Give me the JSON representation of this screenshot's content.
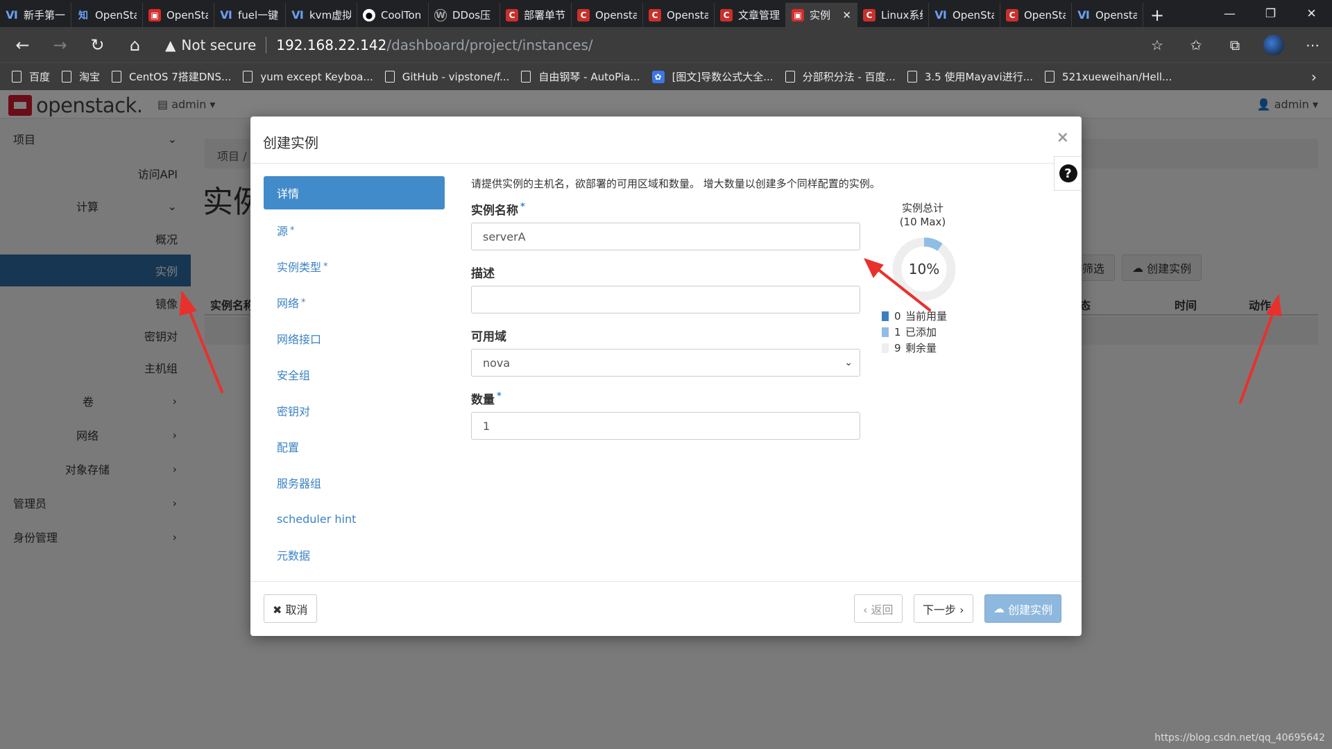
{
  "browser": {
    "tabs": [
      {
        "icon": "vk-icon",
        "title": "新手第一"
      },
      {
        "icon": "zhihu-icon",
        "title": "OpenSta"
      },
      {
        "icon": "openstack-icon",
        "title": "OpenSta"
      },
      {
        "icon": "vk-icon",
        "title": "fuel一键"
      },
      {
        "icon": "vk-icon",
        "title": "kvm虚拟"
      },
      {
        "icon": "github-icon",
        "title": "CoolTon"
      },
      {
        "icon": "wordpress-icon",
        "title": "DDos压"
      },
      {
        "icon": "csdn-icon",
        "title": "部署单节"
      },
      {
        "icon": "csdn-icon",
        "title": "Opensta"
      },
      {
        "icon": "csdn-icon",
        "title": "Opensta"
      },
      {
        "icon": "csdn-icon",
        "title": "文章管理"
      },
      {
        "icon": "openstack-icon",
        "title": "实例",
        "active": true
      },
      {
        "icon": "csdn-icon",
        "title": "Linux系统"
      },
      {
        "icon": "vk-icon",
        "title": "OpenSta"
      },
      {
        "icon": "csdn-icon",
        "title": "OpenSta"
      },
      {
        "icon": "vk-icon",
        "title": "Opensta"
      }
    ],
    "not_secure": "Not secure",
    "url_host": "192.168.22.142",
    "url_path": "/dashboard/project/instances/",
    "bookmarks": [
      {
        "icon": "page-icon",
        "label": "百度"
      },
      {
        "icon": "page-icon",
        "label": "淘宝"
      },
      {
        "icon": "page-icon",
        "label": "CentOS 7搭建DNS..."
      },
      {
        "icon": "page-icon",
        "label": "yum except Keyboa..."
      },
      {
        "icon": "page-icon",
        "label": "GitHub - vipstone/f..."
      },
      {
        "icon": "page-icon",
        "label": "自由钢琴 - AutoPia..."
      },
      {
        "icon": "baidu-paw-icon",
        "label": "[图文]导数公式大全..."
      },
      {
        "icon": "page-icon",
        "label": "分部积分法 - 百度..."
      },
      {
        "icon": "page-icon",
        "label": "3.5 使用Mayavi进行..."
      },
      {
        "icon": "page-icon",
        "label": "521xueweihan/Hell..."
      }
    ]
  },
  "openstack": {
    "logo_text": "openstack.",
    "project_dropdown": "admin ▾",
    "user_dropdown": "admin ▾",
    "sidebar": {
      "project": "项目",
      "api_access": "访问API",
      "compute": "计算",
      "overview": "概况",
      "instances": "实例",
      "images": "镜像",
      "keypairs": "密钥对",
      "server_groups": "主机组",
      "volumes": "卷",
      "network": "网络",
      "object_store": "对象存储",
      "admin": "管理员",
      "identity": "身份管理"
    },
    "breadcrumb": "项目 /",
    "page_title": "实例",
    "filter_button": "筛选",
    "launch_button": "创建实例",
    "table_headers": {
      "name": "实例名称",
      "status": "状态",
      "time": "时间",
      "actions": "动作"
    }
  },
  "modal": {
    "title": "创建实例",
    "close": "×",
    "help": "?",
    "steps": [
      {
        "label": "详情",
        "required": false,
        "active": true
      },
      {
        "label": "源",
        "required": true
      },
      {
        "label": "实例类型",
        "required": true
      },
      {
        "label": "网络",
        "required": true
      },
      {
        "label": "网络接口",
        "required": false
      },
      {
        "label": "安全组",
        "required": false
      },
      {
        "label": "密钥对",
        "required": false
      },
      {
        "label": "配置",
        "required": false
      },
      {
        "label": "服务器组",
        "required": false
      },
      {
        "label": "scheduler hint",
        "required": false
      },
      {
        "label": "元数据",
        "required": false
      }
    ],
    "required_mark": "*",
    "intro": "请提供实例的主机名，欲部署的可用区域和数量。 增大数量以创建多个同样配置的实例。",
    "fields": {
      "name_label": "实例名称",
      "name_value": "serverA",
      "desc_label": "描述",
      "desc_value": "",
      "az_label": "可用域",
      "az_value": "nova",
      "count_label": "数量",
      "count_value": "1"
    },
    "quota": {
      "title": "实例总计",
      "max": "(10 Max)",
      "percent_label": "10%",
      "percent": 10,
      "legend": [
        {
          "value": "0",
          "label": "当前用量",
          "color": "#3a7fc1"
        },
        {
          "value": "1",
          "label": "已添加",
          "color": "#8fbde6"
        },
        {
          "value": "9",
          "label": "剩余量",
          "color": "#eeeeee"
        }
      ]
    },
    "footer": {
      "cancel": "✖ 取消",
      "back": "‹ 返回",
      "next": "下一步 ›",
      "create": "创建实例"
    }
  },
  "watermark": "https://blog.csdn.net/qq_40695642",
  "colors": {
    "accent": "#428bca",
    "sidebar_active": "#2e6da4",
    "arrow": "#e8312c"
  }
}
